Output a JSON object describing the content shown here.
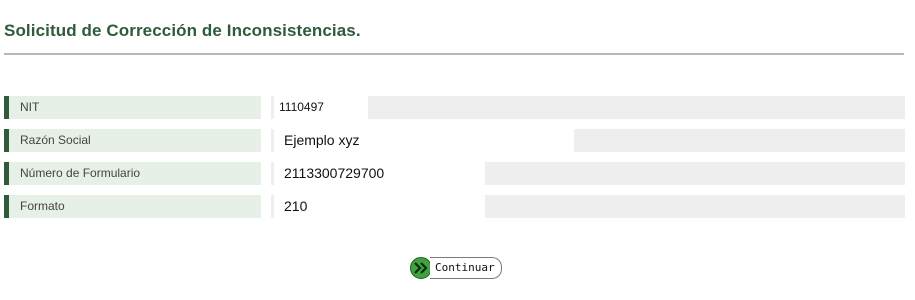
{
  "page": {
    "title": "Solicitud de Corrección de Inconsistencias."
  },
  "form": {
    "fields": [
      {
        "label": "NIT",
        "value": "1110497"
      },
      {
        "label": "Razón Social",
        "value": "Ejemplo xyz"
      },
      {
        "label": "Número de Formulario",
        "value": "2113300729700"
      },
      {
        "label": "Formato",
        "value": "210"
      }
    ]
  },
  "actions": {
    "continue_label": "Continuar",
    "continue_icon": "double-chevron-right-icon"
  },
  "colors": {
    "accent": "#2f5b3a",
    "label_bg": "#e6f0e6",
    "value_bg": "#eeeeee",
    "button_icon": "#3fa13f"
  }
}
